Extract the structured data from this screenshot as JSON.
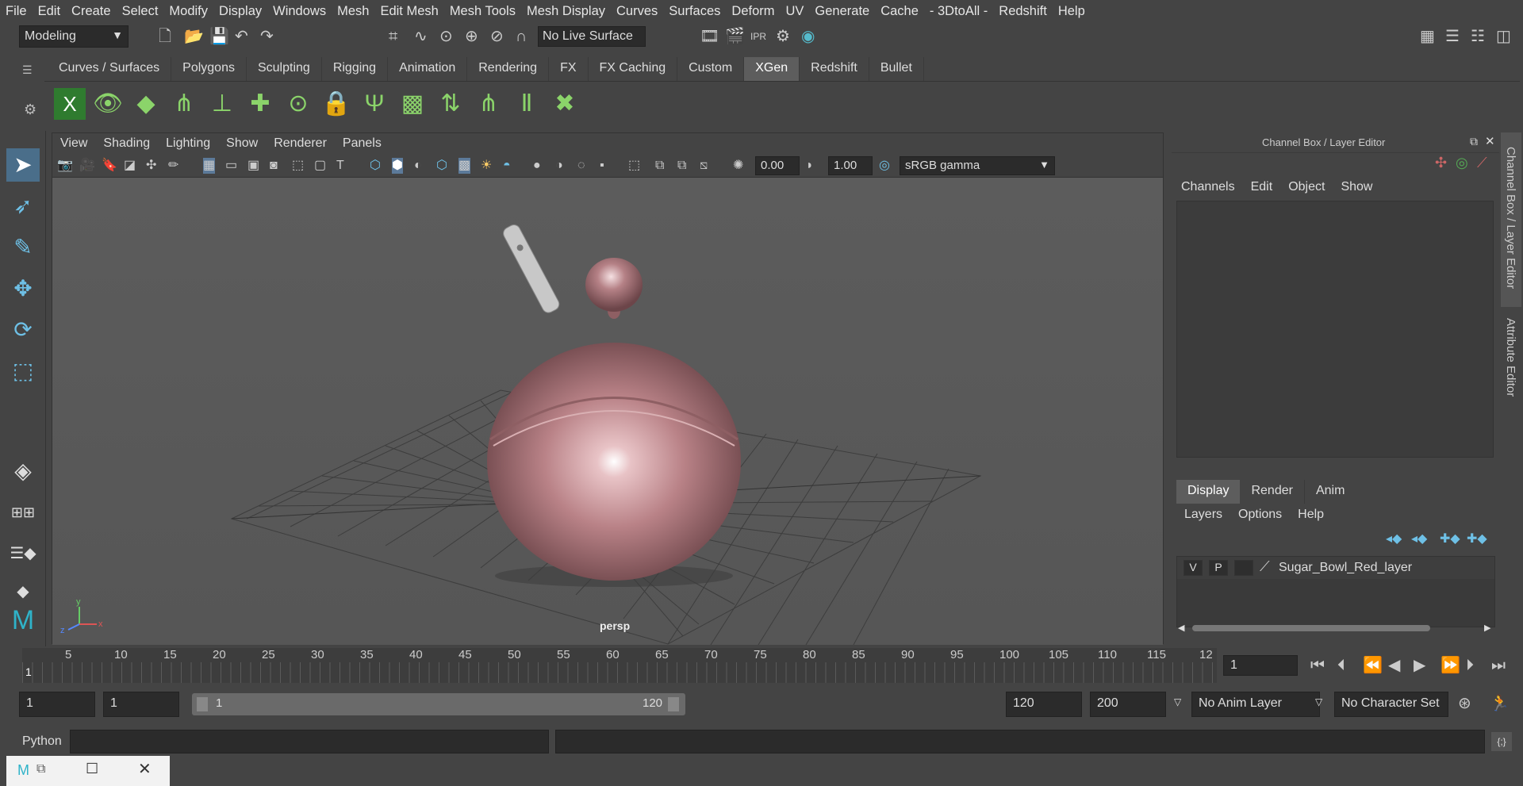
{
  "menus": [
    "File",
    "Edit",
    "Create",
    "Select",
    "Modify",
    "Display",
    "Windows",
    "Mesh",
    "Edit Mesh",
    "Mesh Tools",
    "Mesh Display",
    "Curves",
    "Surfaces",
    "Deform",
    "UV",
    "Generate",
    "Cache",
    "- 3DtoAll -",
    "Redshift",
    "Help"
  ],
  "status": {
    "mode": "Modeling",
    "live_surface": "No Live Surface"
  },
  "shelf_tabs": [
    "Curves / Surfaces",
    "Polygons",
    "Sculpting",
    "Rigging",
    "Animation",
    "Rendering",
    "FX",
    "FX Caching",
    "Custom",
    "XGen",
    "Redshift",
    "Bullet"
  ],
  "shelf_active": "XGen",
  "viewport": {
    "menus": [
      "View",
      "Shading",
      "Lighting",
      "Show",
      "Renderer",
      "Panels"
    ],
    "exposure": "0.00",
    "gamma": "1.00",
    "color_space": "sRGB gamma",
    "camera_label": "persp",
    "axis_x": "x",
    "axis_y": "y",
    "axis_z": "z"
  },
  "channel_box": {
    "title": "Channel Box / Layer Editor",
    "menus": [
      "Channels",
      "Edit",
      "Object",
      "Show"
    ]
  },
  "layer_editor": {
    "tabs": [
      "Display",
      "Render",
      "Anim"
    ],
    "active_tab": "Display",
    "menus": [
      "Layers",
      "Options",
      "Help"
    ],
    "layer": {
      "v": "V",
      "p": "P",
      "name": "Sugar_Bowl_Red_layer"
    }
  },
  "side_tabs": [
    "Channel Box / Layer Editor",
    "Attribute Editor"
  ],
  "timeline": {
    "ticks": [
      "5",
      "10",
      "15",
      "20",
      "25",
      "30",
      "35",
      "40",
      "45",
      "50",
      "55",
      "60",
      "65",
      "70",
      "75",
      "80",
      "85",
      "90",
      "95",
      "100",
      "105",
      "110",
      "115",
      "12"
    ],
    "current_frame_marker": "1",
    "current_frame": "1"
  },
  "range": {
    "start": "1",
    "playback_start": "1",
    "slider_start": "1",
    "slider_end": "120",
    "playback_end": "120",
    "end": "200",
    "anim_layer": "No Anim Layer",
    "character_set": "No Character Set"
  },
  "command_line": {
    "language": "Python"
  }
}
